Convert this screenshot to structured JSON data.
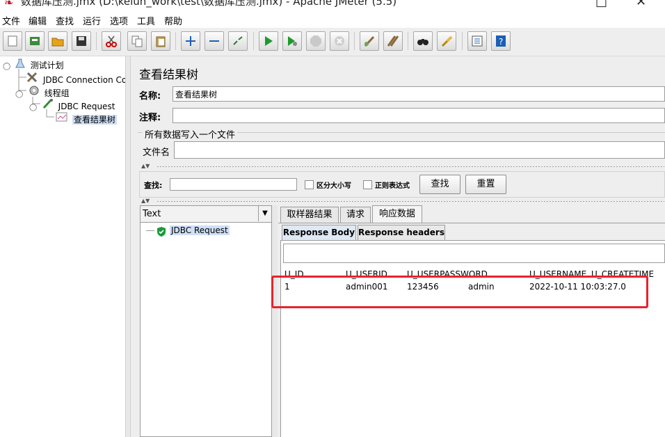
{
  "window": {
    "title": "数据库压测.jmx (D:\\kelun_work\\test\\数据库压测.jmx) - Apache JMeter (5.5)"
  },
  "menu": [
    "文件",
    "编辑",
    "查找",
    "运行",
    "选项",
    "工具",
    "帮助"
  ],
  "toolbar": {
    "buttons": [
      "new-icon",
      "templates-icon",
      "open-icon",
      "save-icon",
      "cut-icon",
      "copy-icon",
      "paste-icon",
      "expand-icon",
      "collapse-icon",
      "toggle-icon",
      "start-icon",
      "start-no-pause-icon",
      "stop-icon",
      "shutdown-icon",
      "clear-icon",
      "clear-all-icon",
      "search-icon",
      "reset-search-icon",
      "function-helper-icon",
      "help-icon"
    ]
  },
  "tree": {
    "items": [
      {
        "label": "测试计划",
        "icon": "test-plan-icon"
      },
      {
        "label": "JDBC Connection Co",
        "icon": "config-tools-icon"
      },
      {
        "label": "线程组",
        "icon": "thread-group-gear-icon"
      },
      {
        "label": "JDBC Request",
        "icon": "sampler-pipette-icon"
      },
      {
        "label": "查看结果树",
        "icon": "listener-chart-icon"
      }
    ]
  },
  "panel": {
    "title": "查看结果树",
    "name_label": "名称:",
    "name_value": "查看结果树",
    "comment_label": "注释:",
    "comment_value": "",
    "file_section_label": "所有数据写入一个文件",
    "filename_label": "文件名",
    "filename_value": ""
  },
  "search": {
    "label": "查找:",
    "value": "",
    "case_sensitive_label": "区分大小写",
    "regex_label": "正则表达式",
    "find_button": "查找",
    "reset_button": "重置"
  },
  "results": {
    "renderer": "Text",
    "items": [
      {
        "label": "JDBC Request",
        "status": "success"
      }
    ],
    "tabs": [
      "取样器结果",
      "请求",
      "响应数据"
    ],
    "active_tab": "响应数据",
    "subtabs": [
      "Response Body",
      "Response headers"
    ],
    "active_subtab": "Response Body",
    "table": {
      "headers": [
        "U_ID",
        "U_USERID",
        "U_USERPASSWORD",
        "U_USERNAME",
        "U_CREATETIME"
      ],
      "rows": [
        [
          "1",
          "admin001",
          "123456",
          "admin",
          "2022-10-11 10:03:27.0"
        ]
      ]
    },
    "highlight_color": "#e8232b"
  }
}
